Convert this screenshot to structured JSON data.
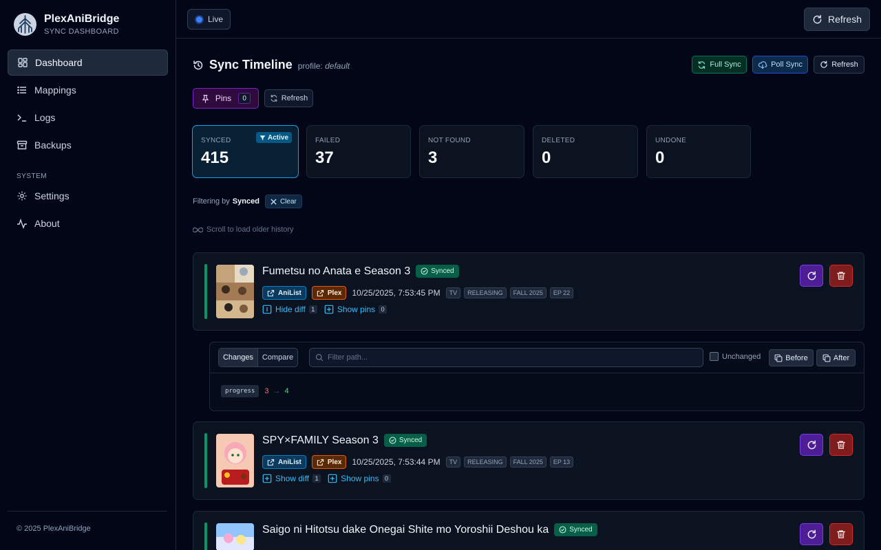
{
  "brand": {
    "title": "PlexAniBridge",
    "subtitle": "SYNC DASHBOARD"
  },
  "sidebar": {
    "items": [
      {
        "label": "Dashboard",
        "icon": "dashboard-icon"
      },
      {
        "label": "Mappings",
        "icon": "list-icon"
      },
      {
        "label": "Logs",
        "icon": "terminal-icon"
      },
      {
        "label": "Backups",
        "icon": "archive-icon"
      }
    ],
    "section_label": "SYSTEM",
    "system_items": [
      {
        "label": "Settings",
        "icon": "gear-icon"
      },
      {
        "label": "About",
        "icon": "activity-icon"
      }
    ],
    "copyright": "© 2025 PlexAniBridge"
  },
  "topbar": {
    "live_label": "Live",
    "refresh_label": "Refresh"
  },
  "header": {
    "title": "Sync Timeline",
    "profile_prefix": "profile:",
    "profile_name": "default",
    "full_sync_label": "Full Sync",
    "poll_sync_label": "Poll Sync",
    "refresh_label": "Refresh",
    "pins_label": "Pins",
    "pins_count": "0",
    "refresh_small_label": "Refresh"
  },
  "stats": [
    {
      "label": "SYNCED",
      "value": "415",
      "active": true,
      "badge": "Active"
    },
    {
      "label": "FAILED",
      "value": "37"
    },
    {
      "label": "NOT FOUND",
      "value": "3"
    },
    {
      "label": "DELETED",
      "value": "0"
    },
    {
      "label": "UNDONE",
      "value": "0"
    }
  ],
  "filter": {
    "prefix": "Filtering by",
    "value": "Synced",
    "clear_label": "Clear"
  },
  "scroll_hint": "Scroll to load older history",
  "timeline": [
    {
      "title": "Fumetsu no Anata e Season 3",
      "status": "Synced",
      "anilist_label": "AniList",
      "plex_label": "Plex",
      "date": "10/25/2025, 7:53:45 PM",
      "tags": [
        "TV",
        "RELEASING",
        "FALL 2025",
        "EP 22"
      ],
      "diff_label": "Hide diff",
      "diff_count": "1",
      "pins_label": "Show pins",
      "pins_count": "0"
    },
    {
      "title": "SPY×FAMILY Season 3",
      "status": "Synced",
      "anilist_label": "AniList",
      "plex_label": "Plex",
      "date": "10/25/2025, 7:53:44 PM",
      "tags": [
        "TV",
        "RELEASING",
        "FALL 2025",
        "EP 13"
      ],
      "diff_label": "Show diff",
      "diff_count": "1",
      "pins_label": "Show pins",
      "pins_count": "0"
    },
    {
      "title": "Saigo ni Hitotsu dake Onegai Shite mo Yoroshii Deshou ka",
      "status": "Synced"
    }
  ],
  "diff": {
    "tab_changes": "Changes",
    "tab_compare": "Compare",
    "search_placeholder": "Filter path...",
    "unchanged_label": "Unchanged",
    "before_label": "Before",
    "after_label": "After",
    "field": "progress",
    "old_value": "3",
    "arrow": "→",
    "new_value": "4"
  },
  "colors": {
    "accent_blue": "#0ea5e9",
    "synced_green": "#059669",
    "anilist_blue": "#0284c7",
    "plex_orange": "#ea580c",
    "resync_purple": "#7c3aed",
    "delete_red": "#dc2626"
  }
}
